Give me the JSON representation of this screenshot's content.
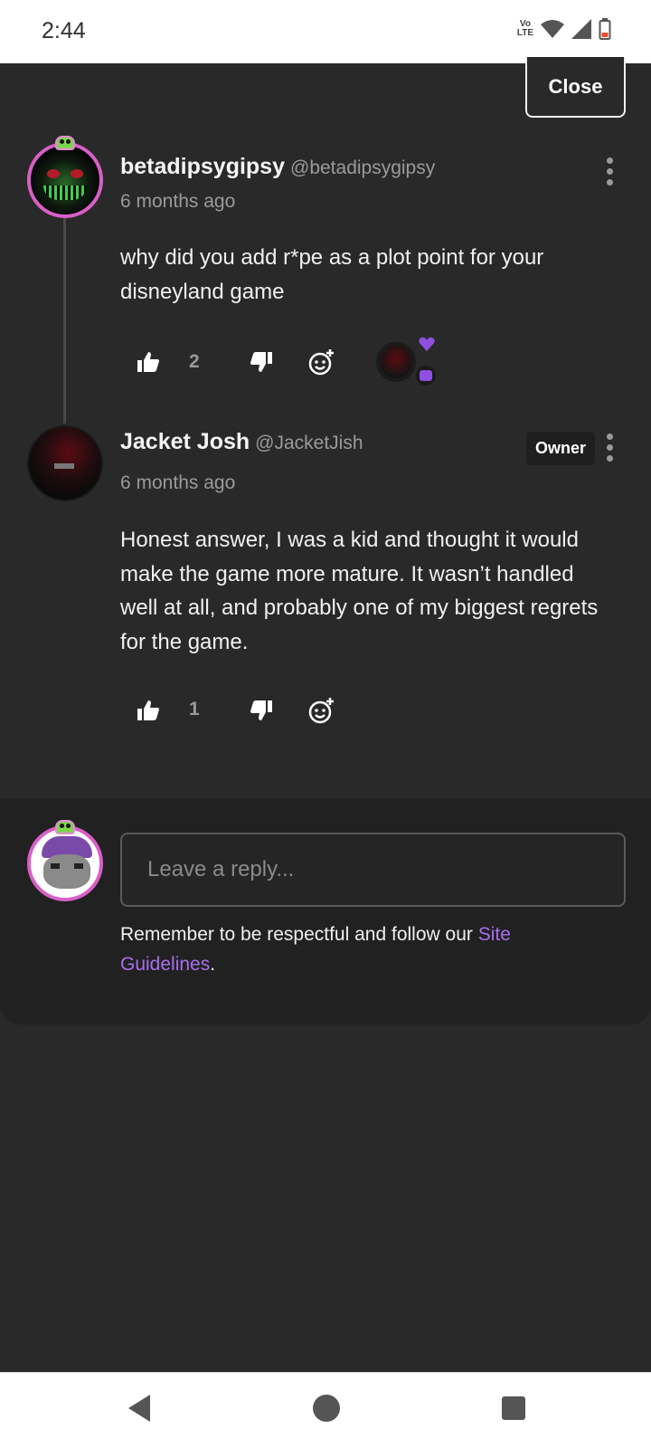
{
  "status_bar": {
    "time": "2:44",
    "network_label": "Vo LTE"
  },
  "close_label": "Close",
  "comments": [
    {
      "author": "betadipsygipsy",
      "handle": "@betadipsygipsy",
      "time_ago": "6 months ago",
      "text": "why did you add r*pe as a plot point for your disneyland game",
      "likes": "2"
    },
    {
      "author": "Jacket Josh",
      "handle": "@JacketJish",
      "badge": "Owner",
      "time_ago": "6 months ago",
      "text": "Honest answer, I was a kid and thought it would make the game more mature. It wasn’t handled well at all, and probably one of my biggest regrets for the game.",
      "likes": "1"
    }
  ],
  "reply": {
    "placeholder": "Leave a reply...",
    "note_prefix": "Remember to be respectful and follow our ",
    "note_link": "Site Guidelines",
    "note_suffix": "."
  },
  "colors": {
    "accent": "#a86ef0",
    "avatar_ring": "#d95fc8",
    "background": "#292929"
  }
}
